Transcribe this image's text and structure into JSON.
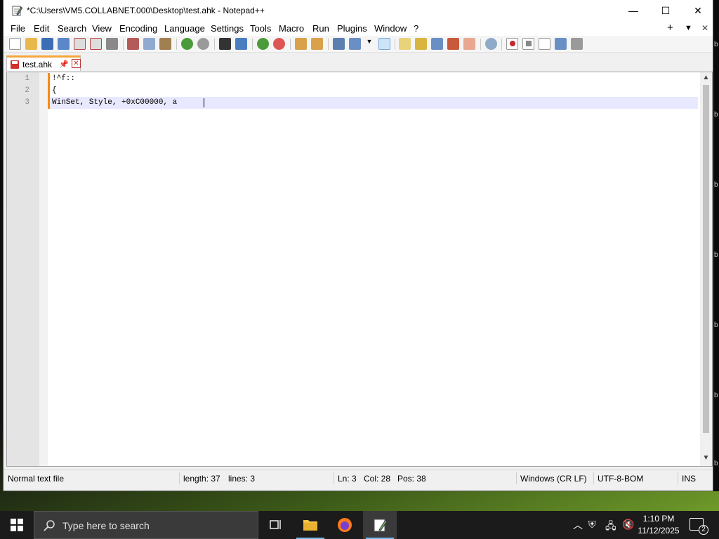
{
  "window": {
    "title": "*C:\\Users\\VM5.COLLABNET.000\\Desktop\\test.ahk - Notepad++",
    "minimize_glyph": "—",
    "maximize_glyph": "☐",
    "close_glyph": "✕"
  },
  "menubar": {
    "items": [
      "File",
      "Edit",
      "Search",
      "View",
      "Encoding",
      "Language",
      "Settings",
      "Tools",
      "Macro",
      "Run",
      "Plugins",
      "Window",
      "?"
    ],
    "right_plus": "+",
    "right_dropdown": "▼",
    "right_close": "✕"
  },
  "toolbar": {
    "icons": [
      "new-file-icon",
      "open-file-icon",
      "save-icon",
      "save-all-icon",
      "close-icon",
      "close-all-icon",
      "print-icon",
      "cut-icon",
      "copy-icon",
      "paste-icon",
      "undo-icon",
      "redo-icon",
      "find-icon",
      "replace-icon",
      "zoom-in-icon",
      "zoom-out-icon",
      "sync-vertical-icon",
      "sync-horizontal-icon",
      "word-wrap-icon",
      "show-all-chars-icon",
      "dropdown-icon",
      "indent-guide-icon",
      "user-defined-lang-icon",
      "doc-map-icon",
      "doc-list-icon",
      "function-list-icon",
      "folder-workspace-icon",
      "monitoring-icon",
      "record-macro-icon",
      "stop-record-icon",
      "play-macro-icon",
      "run-macro-multiple-icon",
      "save-macro-icon"
    ]
  },
  "tabs": [
    {
      "label": "test.ahk",
      "modified": true,
      "active": true
    }
  ],
  "editor": {
    "lines": [
      {
        "number": "1",
        "text": "!^f::"
      },
      {
        "number": "2",
        "text": "{"
      },
      {
        "number": "3",
        "text": "WinSet, Style, +0xC00000, a"
      }
    ],
    "current_line": 3
  },
  "statusbar": {
    "file_type": "Normal text file",
    "length": "length: 37",
    "lines": "lines: 3",
    "ln": "Ln: 3",
    "col": "Col: 28",
    "pos": "Pos: 38",
    "eol": "Windows (CR LF)",
    "encoding": "UTF-8-BOM",
    "mode": "INS"
  },
  "taskbar": {
    "search_placeholder": "Type here to search",
    "time": "1:10 PM",
    "date": "11/12/2025",
    "notification_count": "2"
  },
  "colors": {
    "tab_accent": "#f7a63b",
    "caret_line": "#e8e8ff",
    "change_marker": "#f58a17",
    "taskbar": "#1b1b1b"
  }
}
